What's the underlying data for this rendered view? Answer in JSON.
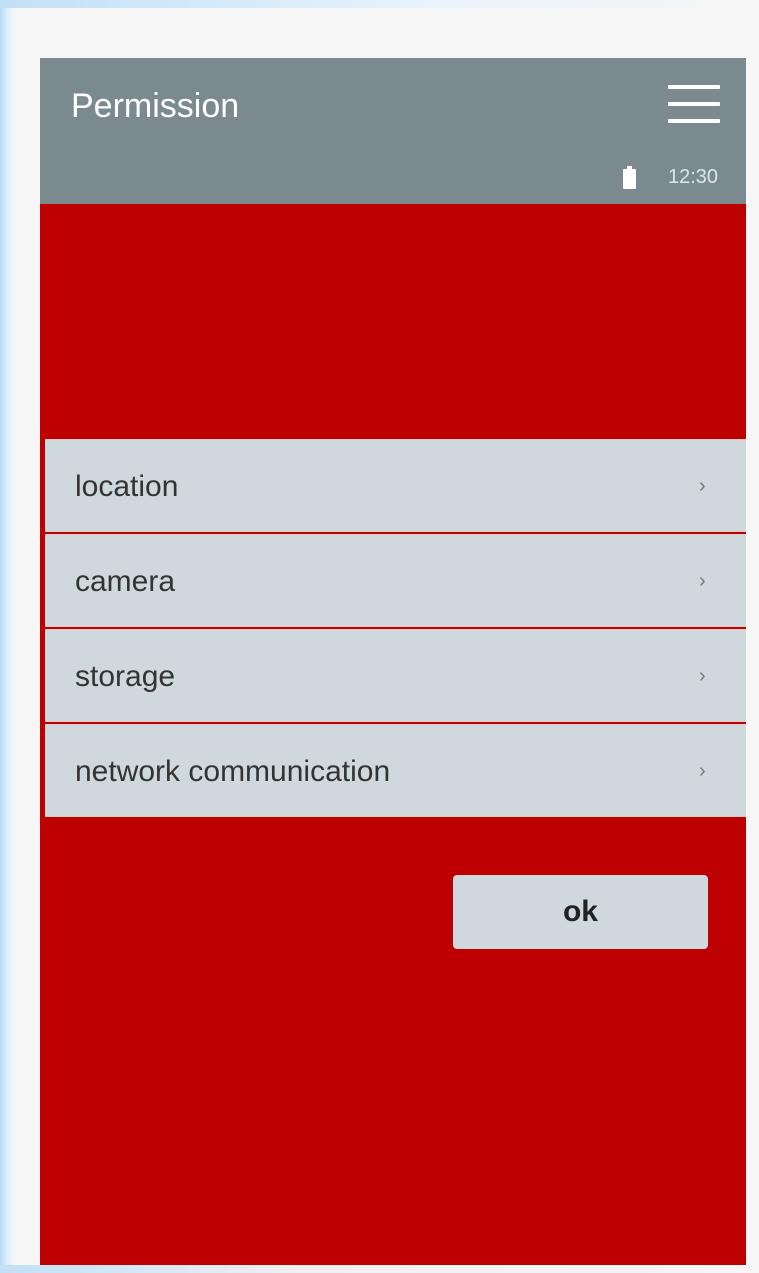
{
  "app_bar": {
    "title": "Permission",
    "menu_icon": "hamburger-menu-icon",
    "status": {
      "battery_icon": "battery-icon",
      "time": "12:30"
    }
  },
  "permissions": {
    "items": [
      {
        "label": "location",
        "chevron": "›"
      },
      {
        "label": "camera",
        "chevron": "›"
      },
      {
        "label": "storage",
        "chevron": "›"
      },
      {
        "label": "network communication",
        "chevron": "›"
      }
    ]
  },
  "actions": {
    "ok_label": "ok"
  },
  "colors": {
    "app_bar": "#7a8a8f",
    "background": "#bd0000",
    "list_item": "#cfd8dd",
    "button": "#cfd8dd"
  }
}
